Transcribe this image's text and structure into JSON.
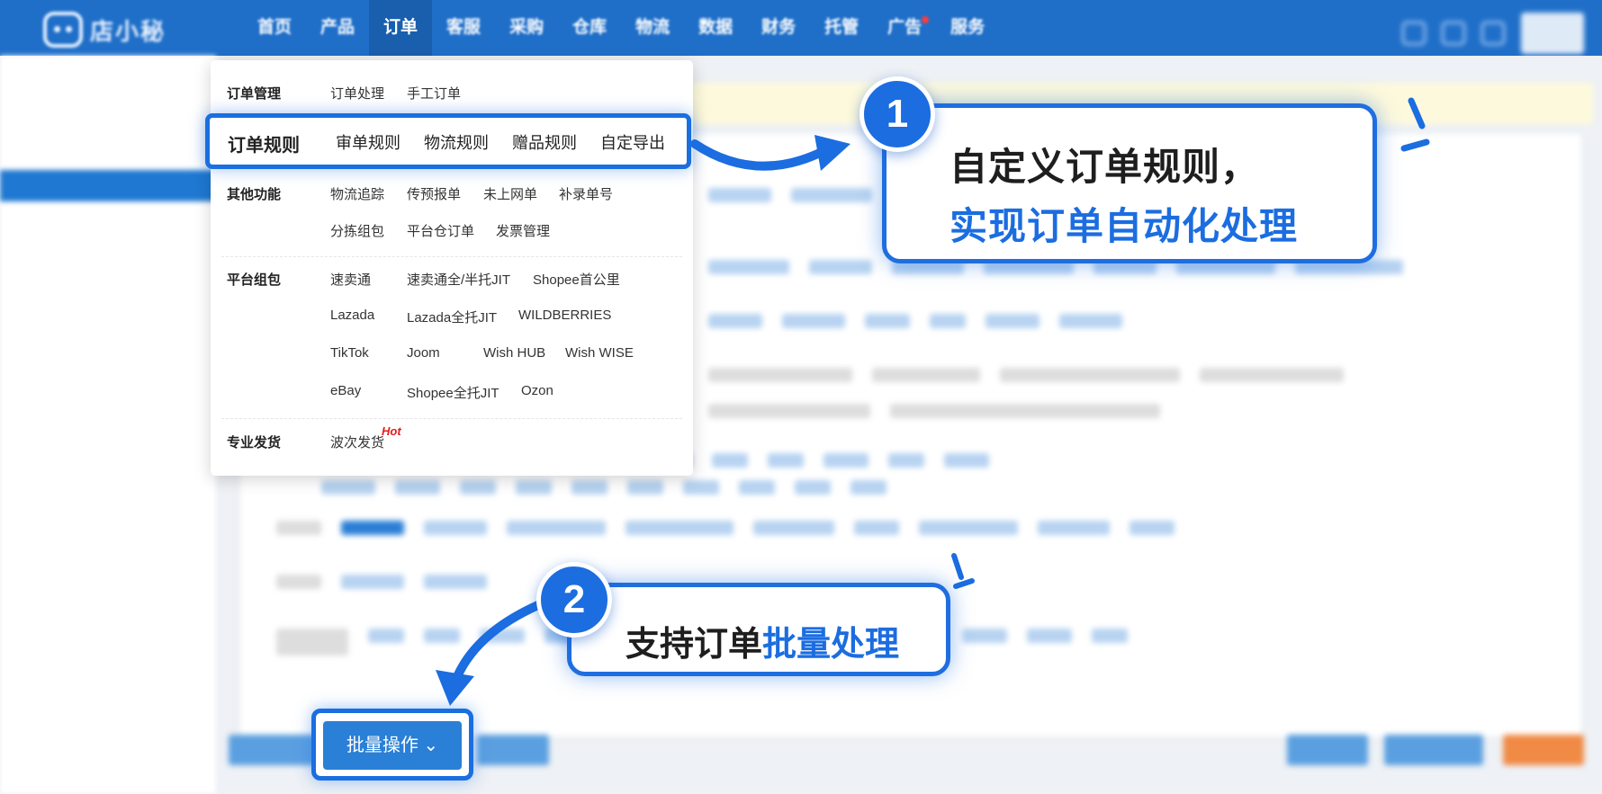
{
  "logo": {
    "text": "店小秘"
  },
  "nav": {
    "items": [
      "首页",
      "产品",
      "订单",
      "客服",
      "采购",
      "仓库",
      "物流",
      "数据",
      "财务",
      "托管",
      "广告",
      "服务"
    ],
    "active": "订单"
  },
  "menu": {
    "order_mgmt": {
      "label": "订单管理",
      "links": [
        "订单处理",
        "手工订单"
      ]
    },
    "order_rules": {
      "label": "订单规则",
      "links": [
        "审单规则",
        "物流规则",
        "赠品规则",
        "自定导出"
      ]
    },
    "other": {
      "label": "其他功能",
      "links_row1": [
        "物流追踪",
        "传预报单",
        "未上网单",
        "补录单号"
      ],
      "links_row2": [
        "分拣组包",
        "平台仓订单",
        "发票管理"
      ]
    },
    "platform": {
      "label": "平台组包",
      "rows": [
        [
          "速卖通",
          "速卖通全/半托JIT",
          "Shopee首公里"
        ],
        [
          "Lazada",
          "Lazada全托JIT",
          "WILDBERRIES"
        ],
        [
          "TikTok",
          "Joom",
          "Wish HUB",
          "Wish WISE"
        ],
        [
          "eBay",
          "Shopee全托JIT",
          "Ozon"
        ]
      ]
    },
    "pro_ship": {
      "label": "专业发货",
      "link": "波次发货",
      "badge": "Hot"
    }
  },
  "callout1": {
    "number": "1",
    "line1": "自定义订单规则，",
    "line2": "实现订单自动化处理"
  },
  "callout2": {
    "number": "2",
    "text_a": "支持订单",
    "text_b": "批量处理"
  },
  "batch_button": {
    "label": "批量操作 ⌄"
  },
  "colors": {
    "primary": "#1b6de0",
    "nav_bg": "#1f6fc9",
    "hot": "#e51c1c"
  }
}
